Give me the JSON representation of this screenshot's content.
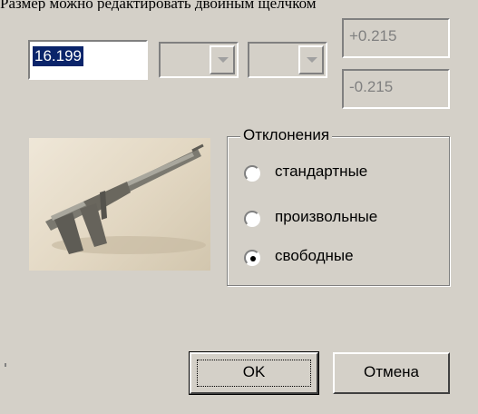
{
  "caption": "Размер можно редактировать двойным щелчком",
  "value": "16.199",
  "upper_tolerance": "+0.215",
  "lower_tolerance": "-0.215",
  "photo_icon": "caliper-photo",
  "group": {
    "title": "Отклонения",
    "options": [
      {
        "label": "стандартные",
        "selected": false
      },
      {
        "label": "произвольные",
        "selected": false
      },
      {
        "label": "свободные",
        "selected": true
      }
    ]
  },
  "buttons": {
    "ok": "OK",
    "cancel": "Отмена"
  },
  "colors": {
    "face": "#d4d0c8",
    "selection": "#0a246a",
    "disabled_text": "#808080"
  }
}
